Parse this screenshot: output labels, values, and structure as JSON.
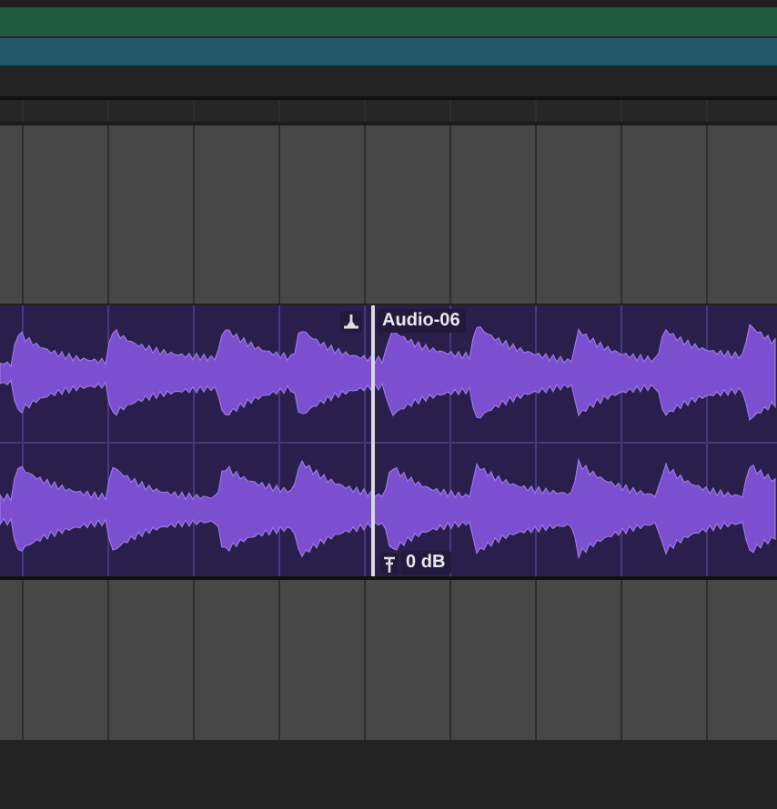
{
  "lanes": [
    {
      "color": "#1f5a3e"
    },
    {
      "color": "#24566a"
    }
  ],
  "clip": {
    "name": "Audio-06",
    "gain": "0 dB"
  }
}
